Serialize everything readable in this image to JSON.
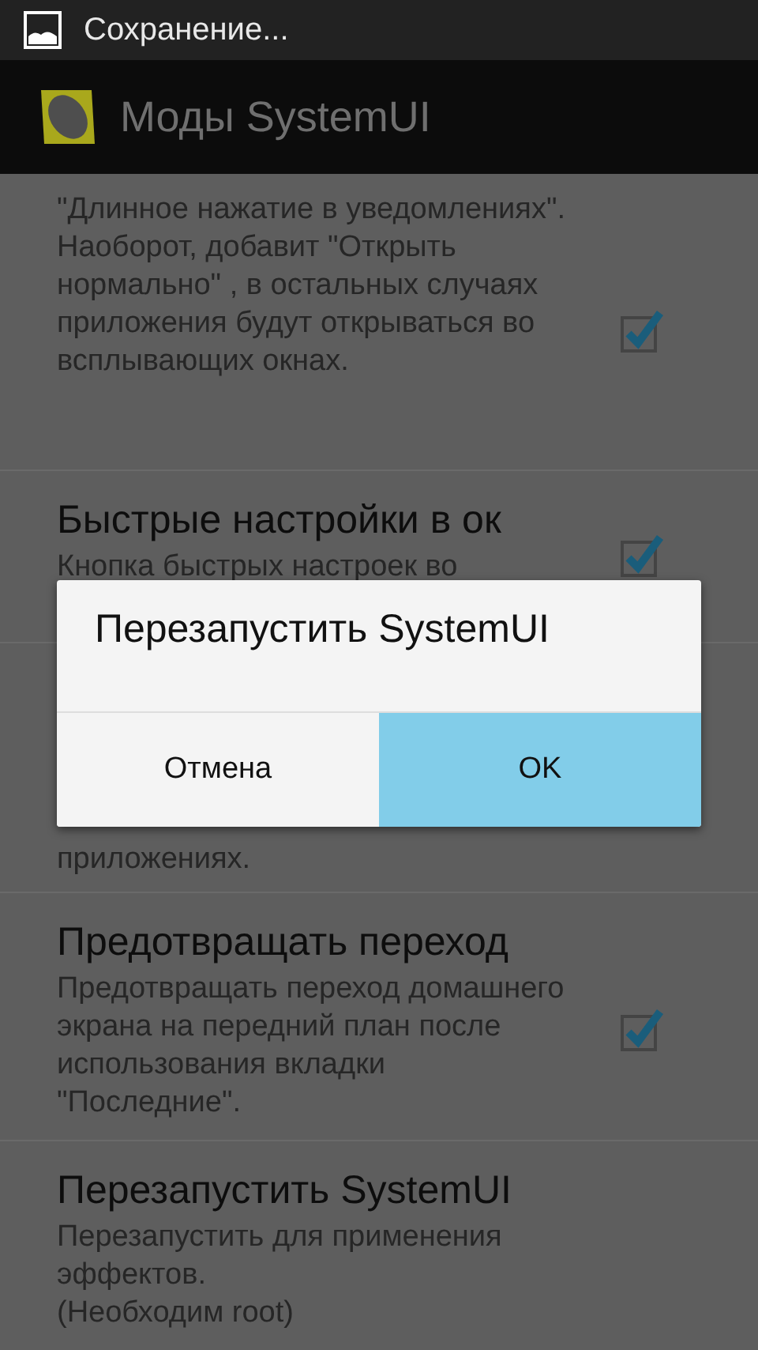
{
  "status_bar": {
    "notification": "Сохранение..."
  },
  "action_bar": {
    "title": "Моды SystemUI"
  },
  "preferences": [
    {
      "kind": "checkbox",
      "summary": "\"Длинное нажатие в уведомлениях\". Наоборот, добавит \"Открыть нормально\" , в остальных случаях приложения будут открываться во всплывающих окнах.",
      "checked": true
    },
    {
      "kind": "checkbox",
      "title": "Быстрые настройки в ок",
      "summary": "Кнопка быстрых настроек во",
      "checked": true
    },
    {
      "kind": "plain",
      "summary": "приложениях."
    },
    {
      "kind": "checkbox",
      "title": "Предотвращать переход",
      "summary": "Предотвращать переход домашнего экрана на передний план после использования вкладки \"Последние\".",
      "checked": true
    },
    {
      "kind": "plain",
      "title": "Перезапустить SystemUI",
      "summary": "Перезапустить для применения эффектов.\n(Необходим root)"
    }
  ],
  "dialog": {
    "title": "Перезапустить SystemUI",
    "buttons": [
      {
        "label": "Отмена",
        "selected": false
      },
      {
        "label": "OK",
        "selected": true
      }
    ]
  }
}
